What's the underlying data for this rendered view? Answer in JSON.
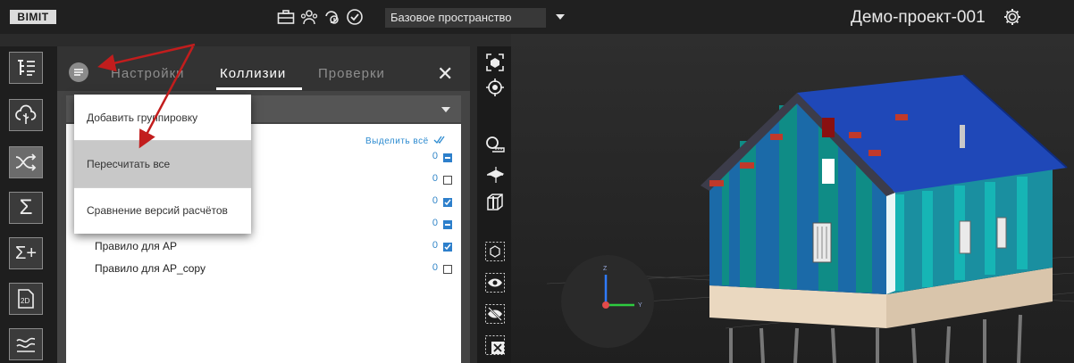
{
  "app": {
    "logo": "BIMIT"
  },
  "topbar": {
    "space_select": {
      "value": "Базовое пространство"
    },
    "project_name": "Демо-проект-001",
    "icons": [
      "briefcase-icon",
      "team-icon",
      "clock-check-icon",
      "check-circle-icon",
      "gear-icon"
    ]
  },
  "left_rail": {
    "buttons": [
      {
        "icon": "tree-structure-icon"
      },
      {
        "icon": "cloud-tree-icon"
      },
      {
        "icon": "shuffle-icon",
        "selected": true
      },
      {
        "icon": "sigma-icon"
      },
      {
        "icon": "sigma-plus-icon"
      },
      {
        "icon": "document-2d-icon"
      },
      {
        "icon": "layers-wave-icon"
      }
    ]
  },
  "panel": {
    "tabs": [
      {
        "label": "Настройки"
      },
      {
        "label": "Коллизии",
        "active": true
      },
      {
        "label": "Проверки"
      }
    ],
    "close_label": "✕",
    "select_all": "Выделить всё",
    "rows": [
      {
        "label": "",
        "count": "0",
        "state": "partial"
      },
      {
        "label": "",
        "count": "0",
        "state": "empty"
      },
      {
        "label": "",
        "count": "0",
        "state": "checked"
      },
      {
        "label": "",
        "count": "0",
        "state": "partial"
      },
      {
        "label": "Правило для АР",
        "count": "0",
        "state": "checked"
      },
      {
        "label": "Правило для АР_copy",
        "count": "0",
        "state": "empty"
      }
    ]
  },
  "dropdown_menu": {
    "items": [
      {
        "label": "Добавить группировку"
      },
      {
        "label": "Пересчитать все",
        "hover": true
      },
      {
        "label": "Сравнение версий расчётов"
      }
    ]
  },
  "view_tools": [
    "focus-icon",
    "target-icon",
    "measure-icon",
    "section-plane-icon",
    "section-box-icon",
    "isolate-icon",
    "show-icon",
    "hide-icon",
    "clear-icon"
  ],
  "axes": {
    "x": "Y",
    "z": "Z"
  },
  "colors": {
    "accent": "#2d7fcb",
    "annotation_arrow": "#c21d1d",
    "house_blue": "#1b6aa8",
    "house_teal": "#0f8c86",
    "roof": "#1f48b8"
  }
}
